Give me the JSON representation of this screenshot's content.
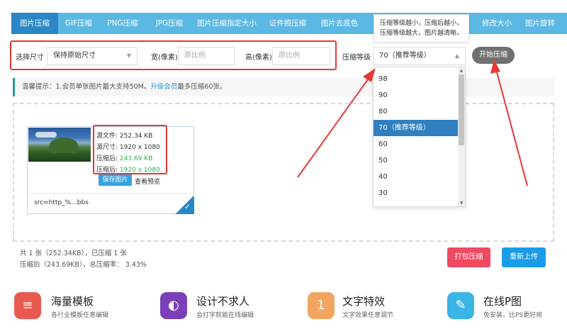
{
  "tabs": [
    "图片压缩",
    "GIF压缩",
    "PNG压缩",
    "JPG压缩",
    "图片压缩指定大小",
    "证件照压缩",
    "图片去底色",
    "批量修改大小",
    "图片旋转"
  ],
  "tabs_hidden_label": "修改大小",
  "tooltip": [
    "压缩等级越小，压缩后越小，",
    "压缩等级越大，图片越清晰。"
  ],
  "options": {
    "size_label": "选择尺寸",
    "size_value": "保持原始尺寸",
    "width_label": "宽(像素)",
    "width_placeholder": "原比例",
    "height_label": "高(像素)",
    "height_placeholder": "原比例",
    "level_label": "压缩等级",
    "level_value": "70（推荐等级）",
    "start_button": "开始压缩"
  },
  "notice": {
    "text1": "温馨提示：1.会员单张图片最大支持50M。",
    "link": "升级会员",
    "text2": "最多压缩60张。"
  },
  "dropdown": [
    "98",
    "90",
    "80",
    "70（推荐等级）",
    "60",
    "50",
    "40",
    "30"
  ],
  "file": {
    "src_size_label": "源文件:",
    "src_size": "252.34 KB",
    "src_dim_label": "源尺寸:",
    "src_dim": "1920 x 1080",
    "out_size_label": "压缩后:",
    "out_size": "243.69 KB",
    "out_dim_label": "压缩后:",
    "out_dim": "1920 x 1080",
    "save_button": "保存图片",
    "preview_link": "查看预览",
    "src": "src=http_%...bbs"
  },
  "summary": {
    "line1": "共 1 张（252.34KB），已压缩 1 张",
    "line2": "压缩后（243.69KB），总压缩率： 3.43%"
  },
  "actions": {
    "pack": "打包压缩",
    "reupload": "重新上传"
  },
  "features": [
    {
      "title": "海量模板",
      "sub": "各行业模板任意编辑",
      "icon": "layers-icon"
    },
    {
      "title": "设计不求人",
      "sub": "会打字就能在线编辑",
      "icon": "palette-icon"
    },
    {
      "title": "文字特效",
      "sub": "文字效果任意调节",
      "icon": "text-effect-icon"
    },
    {
      "title": "在线P图",
      "sub": "免安装，比PS更好用",
      "icon": "brush-icon"
    }
  ],
  "colors": {
    "tab_bg": "#5bb7e3",
    "tab_active": "#2a86c4",
    "annotation_red": "#e53935",
    "pack_button": "#f04a63",
    "reupload_button": "#1a9ce8"
  }
}
